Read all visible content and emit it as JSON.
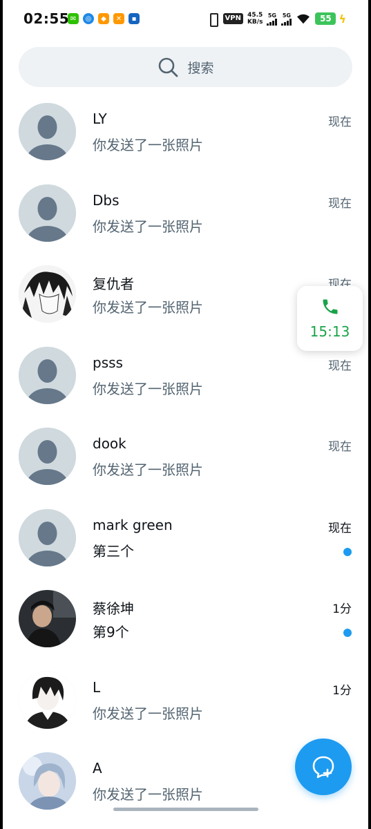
{
  "status_bar": {
    "time": "02:55",
    "vpn": "VPN",
    "speed_value": "45.5",
    "speed_unit": "KB/s",
    "signal1_label": "5G",
    "signal2_label": "5G",
    "battery": "55",
    "app_icons": [
      "wechat-icon",
      "browser-icon",
      "taobao-icon",
      "tools-icon",
      "chat-icon"
    ]
  },
  "search": {
    "label": "搜索"
  },
  "conversations": [
    {
      "name": "LY",
      "preview": "你发送了一张照片",
      "time": "现在",
      "avatar": "default",
      "unread": false
    },
    {
      "name": "Dbs",
      "preview": "你发送了一张照片",
      "time": "现在",
      "avatar": "default",
      "unread": false
    },
    {
      "name": "复仇者",
      "preview": "你发送了一张照片",
      "time": "现在",
      "avatar": "anime-dark-hair",
      "unread": false
    },
    {
      "name": "psss",
      "preview": "你发送了一张照片",
      "time": "现在",
      "avatar": "default",
      "unread": false
    },
    {
      "name": "dook",
      "preview": "你发送了一张照片",
      "time": "现在",
      "avatar": "default",
      "unread": false
    },
    {
      "name": "mark green",
      "preview": "第三个",
      "time": "现在",
      "avatar": "default",
      "unread": true
    },
    {
      "name": "蔡徐坤",
      "preview": "第9个",
      "time": "1分",
      "avatar": "photo-person",
      "unread": true
    },
    {
      "name": "L",
      "preview": "你发送了一张照片",
      "time": "1分",
      "avatar": "anime-boy",
      "unread": false
    },
    {
      "name": "A",
      "preview": "你发送了一张照片",
      "time": "",
      "avatar": "anime-girl",
      "unread": false
    }
  ],
  "call_pill": {
    "duration": "15:13",
    "icon": "phone-icon"
  },
  "fab": {
    "icon": "new-message-icon"
  },
  "colors": {
    "accent": "#1d9bf0",
    "call_green": "#1aa34a",
    "battery_green": "#3cc45a"
  }
}
